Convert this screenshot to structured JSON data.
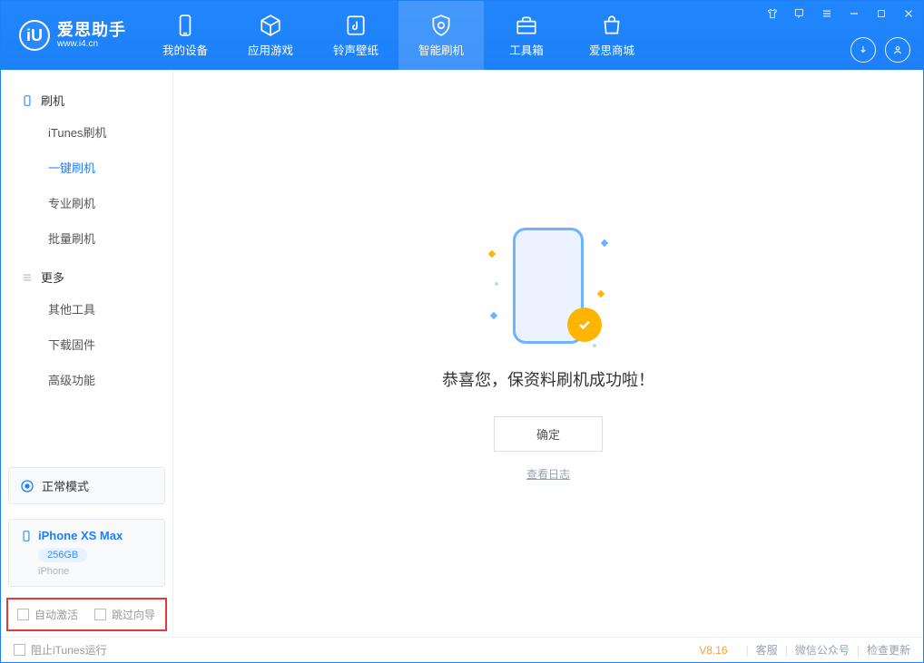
{
  "brand": {
    "title": "爱思助手",
    "subtitle": "www.i4.cn",
    "logo_letter": "iU"
  },
  "nav": [
    {
      "label": "我的设备"
    },
    {
      "label": "应用游戏"
    },
    {
      "label": "铃声壁纸"
    },
    {
      "label": "智能刷机"
    },
    {
      "label": "工具箱"
    },
    {
      "label": "爱思商城"
    }
  ],
  "sidebar": {
    "section_flash": "刷机",
    "section_more": "更多",
    "flash_items": [
      {
        "label": "iTunes刷机"
      },
      {
        "label": "一键刷机"
      },
      {
        "label": "专业刷机"
      },
      {
        "label": "批量刷机"
      }
    ],
    "more_items": [
      {
        "label": "其他工具"
      },
      {
        "label": "下载固件"
      },
      {
        "label": "高级功能"
      }
    ]
  },
  "mode_card": {
    "label": "正常模式"
  },
  "device": {
    "name": "iPhone XS Max",
    "capacity": "256GB",
    "subtype": "iPhone"
  },
  "bottom_options": {
    "auto_activate": "自动激活",
    "skip_guide": "跳过向导"
  },
  "main": {
    "success_title": "恭喜您，保资料刷机成功啦！",
    "ok_label": "确定",
    "view_log": "查看日志"
  },
  "statusbar": {
    "block_itunes": "阻止iTunes运行",
    "version": "V8.16",
    "links": {
      "support": "客服",
      "wechat": "微信公众号",
      "update": "检查更新"
    }
  }
}
